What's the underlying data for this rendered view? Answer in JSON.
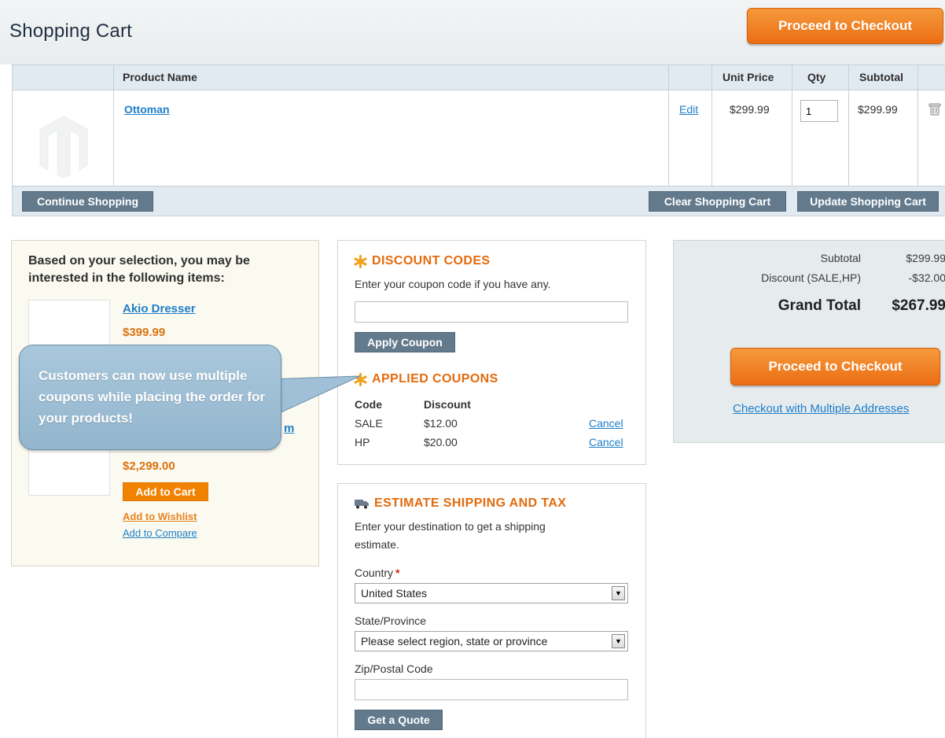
{
  "header": {
    "title": "Shopping Cart",
    "checkout_button": "Proceed to Checkout"
  },
  "cart": {
    "columns": [
      "Product Name",
      "Unit Price",
      "Qty",
      "Subtotal"
    ],
    "items": [
      {
        "name": "Ottoman",
        "edit_label": "Edit",
        "unit_price": "$299.99",
        "qty": "1",
        "subtotal": "$299.99"
      }
    ],
    "continue_button": "Continue Shopping",
    "clear_button": "Clear Shopping Cart",
    "update_button": "Update Shopping Cart"
  },
  "crosssell": {
    "heading": "Based on your selection, you may be interested in the following items:",
    "items": [
      {
        "name": "Akio Dresser",
        "price": "$399.99"
      },
      {
        "name_fragment": "m",
        "price": "$2,299.00"
      }
    ],
    "add_to_cart": "Add to Cart",
    "add_to_wishlist": "Add to Wishlist",
    "add_to_compare": "Add to Compare"
  },
  "callout": {
    "text": "Customers can now use multiple coupons while placing the order for your products!"
  },
  "discount": {
    "heading": "DISCOUNT CODES",
    "description": "Enter your coupon code if you have any.",
    "input_value": "",
    "apply_button": "Apply Coupon",
    "applied_heading": "APPLIED COUPONS",
    "columns": [
      "Code",
      "Discount"
    ],
    "coupons": [
      {
        "code": "SALE",
        "discount": "$12.00",
        "cancel": "Cancel"
      },
      {
        "code": "HP",
        "discount": "$20.00",
        "cancel": "Cancel"
      }
    ]
  },
  "shipping": {
    "heading": "ESTIMATE SHIPPING AND TAX",
    "description_line1": "Enter your destination to get a shipping",
    "description_line2": "estimate.",
    "country_label": "Country",
    "required_mark": "*",
    "country_value": "United States",
    "state_label": "State/Province",
    "state_value": "Please select region, state or province",
    "zip_label": "Zip/Postal Code",
    "zip_value": "",
    "quote_button": "Get a Quote"
  },
  "totals": {
    "subtotal_label": "Subtotal",
    "subtotal_value": "$299.99",
    "discount_label": "Discount (SALE,HP)",
    "discount_value": "-$32.00",
    "grand_label": "Grand Total",
    "grand_value": "$267.99",
    "checkout_button": "Proceed to Checkout",
    "multi_link": "Checkout with Multiple Addresses"
  },
  "colors": {
    "accent_orange": "#ec6d14",
    "link_blue": "#1e7ec8",
    "button_grey": "#637a8c",
    "header_blue": "#e2eaf1"
  }
}
